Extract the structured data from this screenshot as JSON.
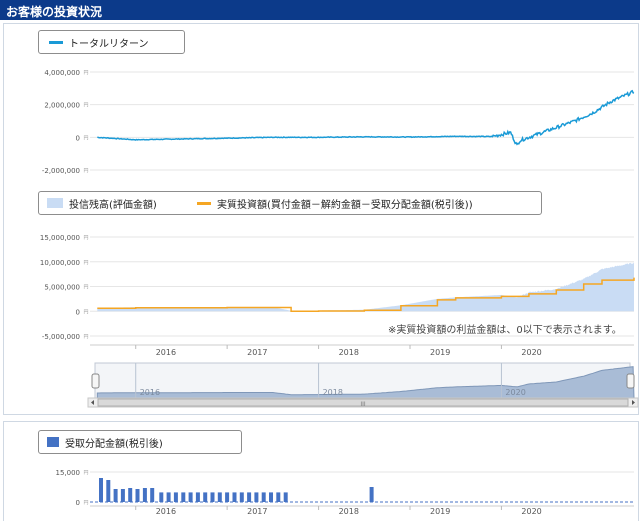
{
  "header": {
    "title": "お客様の投資状況"
  },
  "colors": {
    "header": "#0c3a8a",
    "total_return": "#1a9ad6",
    "net_investment": "#f5a623",
    "balance_fill": "#c9dcf4",
    "dividend_bar": "#4472c4"
  },
  "panel_total_return": {
    "legend": {
      "label": "トータルリターン"
    },
    "yticks": [
      "4,000,000",
      "2,000,000",
      "0",
      "-2,000,000"
    ],
    "unit": "円"
  },
  "panel_balance": {
    "legend": {
      "balance_label": "投信残高(評価金額)",
      "net_label": "実質投資額(買付金額－解約金額－受取分配金額(税引後))"
    },
    "yticks": [
      "15,000,000",
      "10,000,000",
      "5,000,000",
      "0",
      "-5,000,000"
    ],
    "unit": "円",
    "note": "※実質投資額の利益金額は、0以下で表示されます。",
    "xticks": [
      "2016",
      "2017",
      "2018",
      "2019",
      "2020"
    ]
  },
  "navigator": {
    "xticks": [
      "2016",
      "2018",
      "2020"
    ],
    "scroll_grip": "III"
  },
  "panel_dividend": {
    "legend": {
      "label": "受取分配金額(税引後)"
    },
    "yticks": [
      "15,000",
      "0"
    ],
    "unit": "円",
    "xticks": [
      "2016",
      "2017",
      "2018",
      "2019",
      "2020"
    ]
  },
  "chart_data": [
    {
      "type": "line",
      "series": [
        {
          "name": "トータルリターン",
          "x": [
            2015.58,
            2016.0,
            2016.5,
            2017.0,
            2017.5,
            2018.0,
            2018.5,
            2019.0,
            2019.5,
            2019.9,
            2020.1,
            2020.17,
            2020.2,
            2020.5,
            2020.8,
            2021.0,
            2021.2,
            2021.45
          ],
          "values": [
            0,
            -150000,
            -100000,
            -50000,
            0,
            0,
            30000,
            20000,
            60000,
            50000,
            300000,
            -500000,
            -200000,
            400000,
            1000000,
            1500000,
            2200000,
            2800000
          ]
        }
      ],
      "yticks": [
        4000000,
        2000000,
        0,
        -2000000
      ],
      "ylim": [
        -2000000,
        4000000
      ]
    },
    {
      "type": "area",
      "series": [
        {
          "name": "投信残高(評価金額)",
          "x": [
            2015.58,
            2016.0,
            2016.5,
            2017.0,
            2017.5,
            2017.7,
            2018.0,
            2018.5,
            2018.9,
            2019.3,
            2019.5,
            2020.0,
            2020.17,
            2020.3,
            2020.6,
            2020.9,
            2021.1,
            2021.45
          ],
          "values": [
            700000,
            800000,
            800000,
            850000,
            850000,
            100000,
            150000,
            300000,
            1200000,
            2500000,
            2800000,
            3300000,
            2800000,
            3800000,
            4500000,
            6500000,
            8500000,
            9800000
          ]
        },
        {
          "name": "実質投資額(買付金額－解約金額－受取分配金額(税引後))",
          "x": [
            2015.58,
            2016.0,
            2016.5,
            2017.0,
            2017.5,
            2017.7,
            2018.0,
            2018.5,
            2018.9,
            2019.3,
            2019.5,
            2020.0,
            2020.17,
            2020.3,
            2020.6,
            2020.9,
            2021.1,
            2021.45
          ],
          "values": [
            600000,
            700000,
            700000,
            750000,
            750000,
            0,
            50000,
            200000,
            1100000,
            2300000,
            2700000,
            3000000,
            3000000,
            3500000,
            4300000,
            5500000,
            6300000,
            6800000
          ]
        }
      ],
      "yticks": [
        15000000,
        10000000,
        5000000,
        0,
        -5000000
      ],
      "ylim": [
        -5000000,
        15000000
      ]
    },
    {
      "type": "bar",
      "series": [
        {
          "name": "受取分配金額(税引後)",
          "x": [
            2015.62,
            2015.7,
            2015.78,
            2015.86,
            2015.94,
            2016.02,
            2016.1,
            2016.18,
            2016.28,
            2016.36,
            2016.44,
            2016.52,
            2016.6,
            2016.68,
            2016.76,
            2016.84,
            2016.92,
            2017.0,
            2017.08,
            2017.16,
            2017.24,
            2017.32,
            2017.4,
            2017.48,
            2017.56,
            2017.64,
            2018.58
          ],
          "values": [
            12000,
            11000,
            6500,
            6500,
            7000,
            6500,
            7000,
            7000,
            4800,
            4800,
            4800,
            4800,
            4800,
            4800,
            4800,
            4800,
            4800,
            4800,
            4800,
            4800,
            4800,
            4800,
            4800,
            4800,
            4800,
            4800,
            7500
          ]
        }
      ],
      "yticks": [
        15000,
        0
      ],
      "ylim": [
        0,
        15000
      ]
    }
  ]
}
